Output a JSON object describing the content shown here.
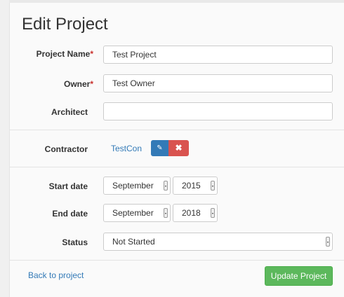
{
  "page": {
    "title": "Edit Project"
  },
  "fields": {
    "project_name": {
      "label": "Project Name",
      "required": "*",
      "value": "Test Project"
    },
    "owner": {
      "label": "Owner",
      "required": "*",
      "value": "Test Owner"
    },
    "architect": {
      "label": "Architect",
      "value": ""
    },
    "contractor": {
      "label": "Contractor",
      "value": "TestCon",
      "edit_icon": "edit-icon",
      "delete_icon": "close-icon",
      "delete_glyph": "✖",
      "edit_glyph": "✎"
    },
    "start_date": {
      "label": "Start date",
      "month": "September",
      "year": "2015"
    },
    "end_date": {
      "label": "End date",
      "month": "September",
      "year": "2018"
    },
    "status": {
      "label": "Status",
      "value": "Not Started"
    }
  },
  "footer": {
    "back_link": "Back to project",
    "submit": "Update Project"
  },
  "colors": {
    "primary": "#337ab7",
    "danger": "#d9534f",
    "success": "#5cb85c",
    "required": "#c9302c"
  }
}
